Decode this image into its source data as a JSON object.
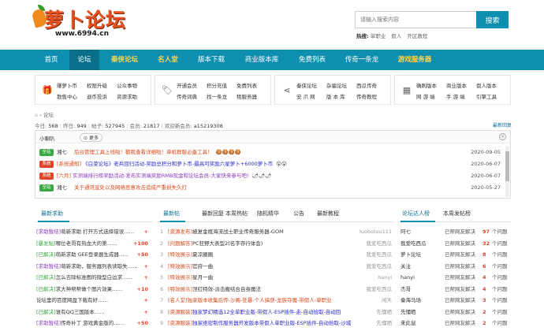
{
  "header": {
    "logo_text": "萝卜论坛",
    "logo_url": "www.6994.cn",
    "search_placeholder": "请输入搜索内容",
    "search_button": "搜索",
    "hot_label": "热搜:",
    "hot_items": [
      "单职业",
      "假人",
      "开区教程"
    ]
  },
  "nav": {
    "items": [
      {
        "label": "首页",
        "color": "#ffffff"
      },
      {
        "label": "论坛",
        "color": "#ffffff",
        "active": true
      },
      {
        "label": "秦侠论坛",
        "color": "#ffd54a"
      },
      {
        "label": "名人堂",
        "color": "#ffd54a"
      },
      {
        "label": "版本下载",
        "color": "#ffffff"
      },
      {
        "label": "商业版本库",
        "color": "#ffffff"
      },
      {
        "label": "免费列表",
        "color": "#ffffff"
      },
      {
        "label": "传奇一条龙",
        "color": "#ffffff"
      },
      {
        "label": "游戏服务器",
        "color": "#ffd54a"
      }
    ]
  },
  "quick": [
    {
      "icon": "gift-icon",
      "glyph": "🎁",
      "links": [
        "赚萝卜币",
        "权限升级",
        "公众事物",
        "散售中心",
        "退币投诉",
        "资源求助"
      ]
    },
    {
      "icon": "tags-icon",
      "glyph": "🏷",
      "links": [
        "开通会员",
        "积分充值",
        "免费列表",
        "传奇词典",
        "找一条龙",
        "租服务器"
      ]
    },
    {
      "icon": "share-icon",
      "glyph": "⋖",
      "links": [
        "秦侠论坛",
        "杂骗论坛",
        "西瓜传奇",
        "安 爪 网",
        "版 本 库",
        "传奇教程"
      ]
    },
    {
      "icon": "grid-icon",
      "glyph": "▦",
      "links": [
        "确刷版本",
        "商业版本",
        "假人版本",
        "网 游 端",
        "手 游 端",
        "引擎工具"
      ]
    }
  ],
  "breadcrumb": {
    "home_icon": "home-icon",
    "label": "论坛"
  },
  "stats": {
    "today_label": "今日:",
    "today": "568",
    "yesterday_label": "昨日:",
    "yesterday": "949",
    "posts_label": "帖子:",
    "posts": "527945",
    "members_label": "会员:",
    "members": "21817",
    "welcome_label": "欢迎新会员:",
    "newest_member": "a15219308",
    "newest_replies": "最新回复"
  },
  "notice": {
    "title": "小喇叭",
    "more": "更多",
    "rows": [
      {
        "tag": "全站",
        "tag_color": "#3aa843",
        "author": "湘七",
        "text": "后台管理工具上线啦！戳我查看详细啦！单机群服必备工具！",
        "text_color": "#d94a1a",
        "emoji": "🍪🍪🍪🍪",
        "date": "2020-09-05"
      },
      {
        "tag": "系统",
        "tag_color": "#e0452a",
        "author": "[系统通知]",
        "text": "《白菜论坛》老兵回归活动-奖励总积分和萝卜币-最高可奖励六星萝卜+6000萝卜币",
        "text_color": "#2a2acc",
        "emoji": "😮😮",
        "date": "2020-06-07"
      },
      {
        "tag": "系统",
        "tag_color": "#e0452a",
        "author": "[六月]",
        "text": "实测端排行榜奖励活动-发布实测端奖励RMB现金和论坛会员-大家快来参与吧!",
        "text_color": "#8a3ac0",
        "emoji": "🌶🌶🌶",
        "date": "2020-06-07"
      },
      {
        "tag": "全站",
        "tag_color": "#3aa843",
        "author": "湘七",
        "text": "关于通讯宣处以及网络恶意攻击造成严重损失久打",
        "text_color": "#d94a1a",
        "emoji": "",
        "date": "2020-05-27"
      }
    ]
  },
  "left_panel": {
    "tab": "最新求助",
    "rows": [
      {
        "status": "[求助暂结]",
        "status_color": "#8a3ac0",
        "text": "萌新求助 打开方式选择错误……",
        "value": "+"
      },
      {
        "status": "[暴发贴]",
        "status_color": "#3aa843",
        "text": "哪位老哥有热血大的第……",
        "value": "+100"
      },
      {
        "status": "[已解决]",
        "status_color": "#3aa843",
        "text": "萌新求助 GEE登录器生成器……",
        "value": "+50"
      },
      {
        "status": "[求助暂结]",
        "status_color": "#8a3ac0",
        "text": "萌新求助，服务器列表读取失……",
        "value": "+"
      },
      {
        "status": "[已解决]",
        "status_color": "#3aa843",
        "text": "怎么去除标准图的微型白边求……",
        "value": "+"
      },
      {
        "status": "[已解决]",
        "status_color": "#3aa843",
        "text": "求大神帮帮做个图片效果……",
        "value": "+10"
      },
      {
        "status": "",
        "status_color": "#333333",
        "text": "论坛里的百度网盘下载有好……",
        "value": "+"
      },
      {
        "status": "[已解决]",
        "status_color": "#3aa843",
        "text": "谁有QQ三国版本……",
        "value": "+"
      },
      {
        "status": "[求助暂结]",
        "status_color": "#8a3ac0",
        "text": "传奇补丁 游戏黄金版的……",
        "value": "+50"
      }
    ]
  },
  "middle_panel": {
    "tabs": [
      "最新帖",
      "最新回复",
      "本周热帖",
      "随机精华",
      "公告",
      "最新教程"
    ],
    "rows": [
      {
        "num": "1",
        "tag": "[资源发布]",
        "tag_color": "#d94a1a",
        "text": "被复金瓶海流战士职业传奇服务器-GOM",
        "text_color": "#333333",
        "author": "luobotou111"
      },
      {
        "num": "2",
        "tag": "[问题解答]",
        "tag_color": "#d94a1a",
        "text": "PC狂野大表型2(名字存行体会)",
        "text_color": "#333333",
        "author": "我爱吃西瓜"
      },
      {
        "num": "3",
        "tag": "[特效展示]",
        "tag_color": "#d94a1a",
        "text": "夏凉圈圈",
        "text_color": "#333333",
        "author": "我爱吃西瓜"
      },
      {
        "num": "4",
        "tag": "[特效展示]",
        "tag_color": "#d94a1a",
        "text": "官府一曲",
        "text_color": "#333333",
        "author": "我爱吃西瓜"
      },
      {
        "num": "5",
        "tag": "[特效展示]",
        "tag_color": "#d94a1a",
        "text": "星月一曲",
        "text_color": "#333333",
        "author": "hanyi"
      },
      {
        "num": "6",
        "tag": "[特效展示]",
        "tag_color": "#d94a1a",
        "text": "涅红特效-派击搬结合自身魔法",
        "text_color": "#333333",
        "author": "我爱吃西瓜"
      },
      {
        "num": "7",
        "tag": "[名人堂]",
        "tag_color": "#d94a1a",
        "text": "独家版本收集后传-沙阁-狂暴-个人搞获-龙族夺魔-带假人-单职业",
        "text_color": "#d94a1a",
        "author": "闲天"
      },
      {
        "num": "8",
        "tag": "[资源服装]",
        "tag_color": "#d94a1a",
        "text": "独家梦幻精选12全单职业版-带假人-ESP插件-走-自动拾取-自动回",
        "text_color": "#2a2acc",
        "author": "先懂晒"
      },
      {
        "num": "9",
        "tag": "[资源服装]",
        "tag_color": "#d94a1a",
        "text": "独家绝密制作服务器开发版本带假人单职业版-ESP插件-自动拾取-沙城",
        "text_color": "#2a2acc",
        "author": "先懂晒"
      }
    ]
  },
  "right_panel": {
    "tabs": [
      "论坛达人榜",
      "本周发帖榜"
    ],
    "rows": [
      {
        "name": "阿七",
        "label": "已帮网友解决",
        "count": "97",
        "unit": "个问题"
      },
      {
        "name": "我爱吃西瓜",
        "label": "已帮网友解决",
        "count": "32",
        "unit": "个问题"
      },
      {
        "name": "萝卜论坛",
        "label": "已帮网友解决",
        "count": "8",
        "unit": "个问题"
      },
      {
        "name": "关注",
        "label": "已帮网友解决",
        "count": "6",
        "unit": "个问题"
      },
      {
        "name": "hanyi",
        "label": "已帮网友解决",
        "count": "4",
        "unit": "个问题"
      },
      {
        "name": "杰哥",
        "label": "已帮网友解决",
        "count": "4",
        "unit": "个问题"
      },
      {
        "name": "秦海马场",
        "label": "已帮网友解决",
        "count": "3",
        "unit": "个问题"
      },
      {
        "name": "先懂晒",
        "label": "已帮网友解决",
        "count": "2",
        "unit": "个问题"
      },
      {
        "name": "来此鼠",
        "label": "已帮网友解决",
        "count": "2",
        "unit": "个问题"
      }
    ]
  }
}
